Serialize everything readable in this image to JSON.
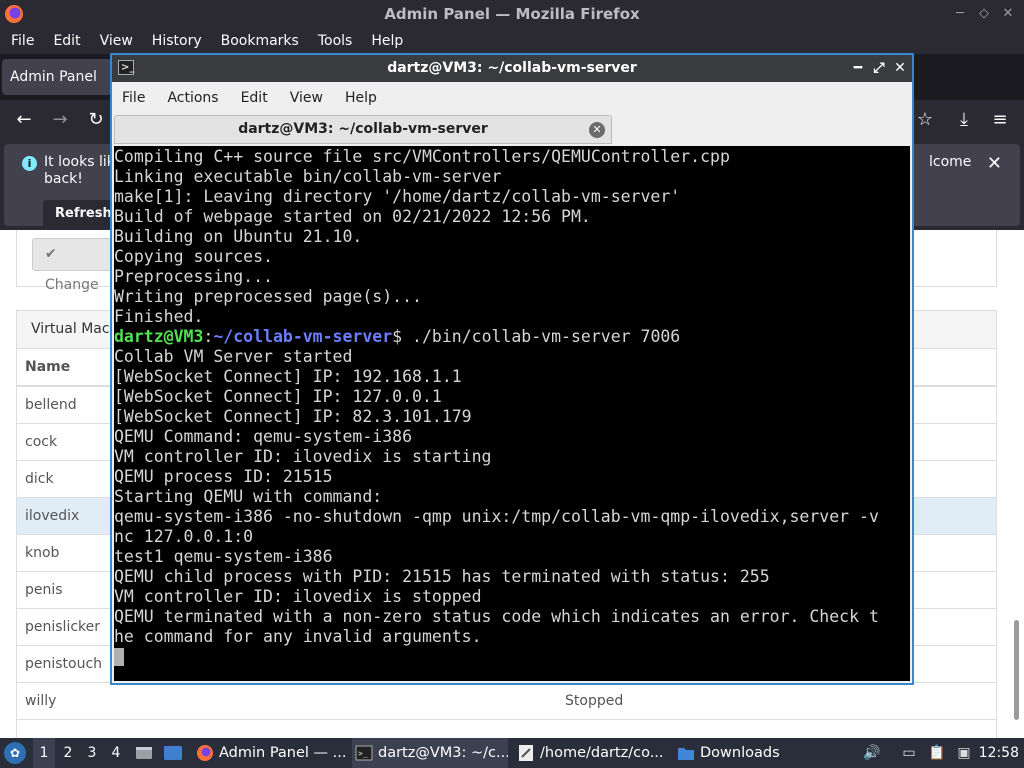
{
  "firefox": {
    "title": "Admin Panel — Mozilla Firefox",
    "menu": [
      "File",
      "Edit",
      "View",
      "History",
      "Bookmarks",
      "Tools",
      "Help"
    ],
    "tab_title": "Admin Panel",
    "notification": {
      "text_start": "It looks lik",
      "text_line2": "back!",
      "text_end": "lcome",
      "refresh_label": "Refresh"
    }
  },
  "page": {
    "change_button": "Change",
    "panel_title": "Virtual Mach",
    "table_header": "Name",
    "rows": [
      {
        "name": "bellend",
        "status": ""
      },
      {
        "name": "cock",
        "status": ""
      },
      {
        "name": "dick",
        "status": ""
      },
      {
        "name": "ilovedix",
        "status": ""
      },
      {
        "name": "knob",
        "status": ""
      },
      {
        "name": "penis",
        "status": ""
      },
      {
        "name": "penislicker",
        "status": ""
      },
      {
        "name": "penistouch",
        "status": ""
      },
      {
        "name": "willy",
        "status": "Stopped"
      }
    ]
  },
  "terminal": {
    "title": "dartz@VM3: ~/collab-vm-server",
    "menu": [
      "File",
      "Actions",
      "Edit",
      "View",
      "Help"
    ],
    "tab_title": "dartz@VM3: ~/collab-vm-server",
    "lines": [
      "Compiling C++ source file src/VMControllers/QEMUController.cpp",
      "Linking executable bin/collab-vm-server",
      "make[1]: Leaving directory '/home/dartz/collab-vm-server'",
      "Build of webpage started on 02/21/2022 12:56 PM.",
      "Building on Ubuntu 21.10.",
      "Copying sources.",
      "Preprocessing...",
      "Writing preprocessed page(s)...",
      "Finished."
    ],
    "prompt": {
      "user": "dartz@VM3",
      "sep": ":",
      "path": "~/collab-vm-server",
      "dollar": "$ ",
      "command": "./bin/collab-vm-server 7006"
    },
    "output": [
      "Collab VM Server started",
      "[WebSocket Connect] IP: 192.168.1.1",
      "[WebSocket Connect] IP: 127.0.0.1",
      "[WebSocket Connect] IP: 82.3.101.179",
      "QEMU Command: qemu-system-i386",
      "VM controller ID: ilovedix is starting",
      "QEMU process ID: 21515",
      "Starting QEMU with command:",
      "qemu-system-i386 -no-shutdown -qmp unix:/tmp/collab-vm-qmp-ilovedix,server -v",
      "nc 127.0.0.1:0",
      "test1 qemu-system-i386",
      "QEMU child process with PID: 21515 has terminated with status: 255",
      "VM controller ID: ilovedix is stopped",
      "QEMU terminated with a non-zero status code which indicates an error. Check t",
      "he command for any invalid arguments."
    ]
  },
  "taskbar": {
    "workspaces": [
      "1",
      "2",
      "3",
      "4"
    ],
    "tasks": [
      {
        "label": "Admin Panel — ...",
        "icon": "firefox-icon"
      },
      {
        "label": "dartz@VM3: ~/c...",
        "icon": "terminal-icon"
      },
      {
        "label": "/home/dartz/co...",
        "icon": "text-editor-icon"
      },
      {
        "label": "Downloads",
        "icon": "folder-icon"
      }
    ],
    "clock": "12:58"
  },
  "colors": {
    "terminal_bg": "#000000",
    "prompt_user": "#53e052",
    "prompt_path": "#6d7dff",
    "window_border_active": "#3b86d1"
  }
}
